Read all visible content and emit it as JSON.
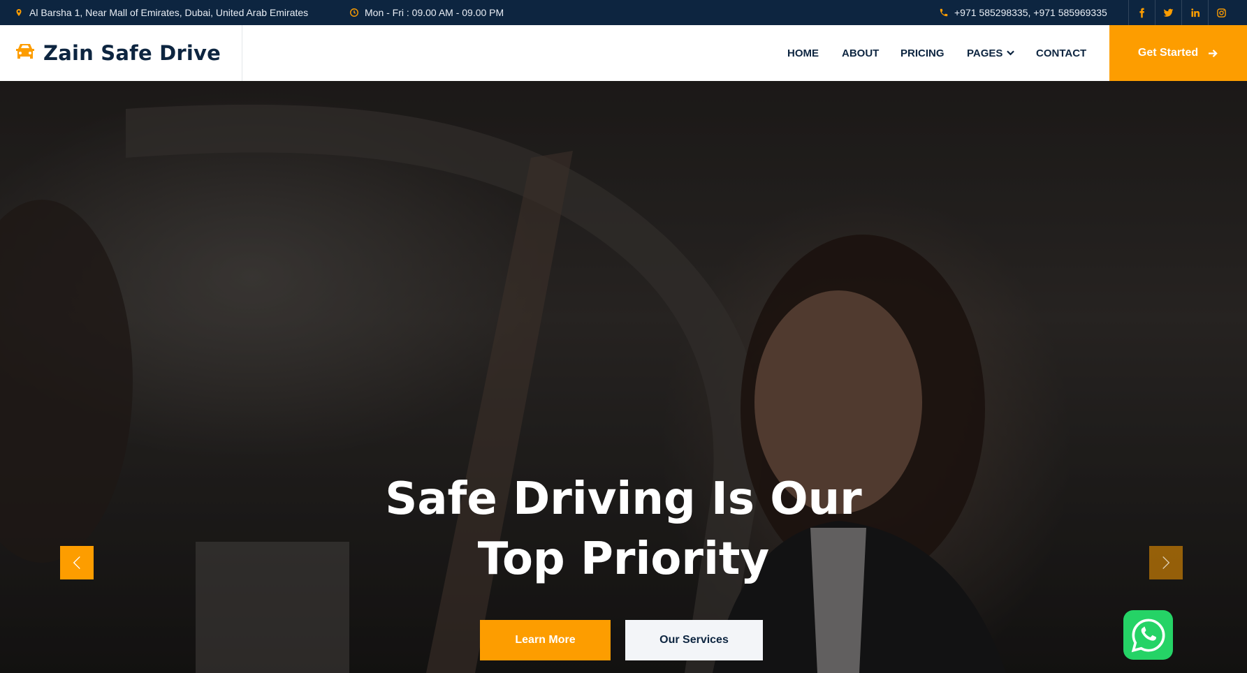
{
  "topbar": {
    "address": "Al Barsha 1, Near Mall of Emirates, Dubai, United Arab Emirates",
    "hours": "Mon - Fri : 09.00 AM - 09.00 PM",
    "phones": "+971 585298335, +971 585969335",
    "icons": {
      "address": "map-pin-icon",
      "hours": "clock-icon",
      "phone": "phone-icon"
    },
    "social": [
      "facebook-icon",
      "twitter-icon",
      "linkedin-icon",
      "instagram-icon"
    ]
  },
  "brand": {
    "name": "Zain Safe Drive",
    "icon": "car-icon"
  },
  "nav": {
    "home": "HOME",
    "about": "ABOUT",
    "pricing": "PRICING",
    "pages": "PAGES",
    "contact": "CONTACT"
  },
  "cta": {
    "label": "Get Started",
    "icon": "arrow-right-icon"
  },
  "hero": {
    "title_line1": "Safe Driving Is Our",
    "title_line2": "Top Priority",
    "primary_button": "Learn More",
    "secondary_button": "Our Services",
    "prev_icon": "chevron-left-icon",
    "next_icon": "chevron-right-icon"
  },
  "colors": {
    "accent": "#fd9d00",
    "navy": "#0d2540",
    "whatsapp": "#25d366"
  }
}
